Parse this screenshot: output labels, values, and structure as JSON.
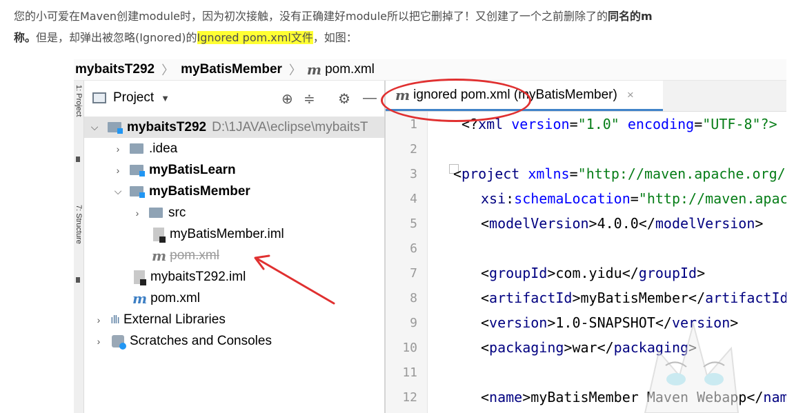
{
  "article": {
    "text_1": "您的小可爱在Maven创建module时，因为初次接触，没有正确建好module所以把它删掉了！又创建了一个之前删除了的",
    "bold_1": "同名的m",
    "bold_2": "称。",
    "text_2": "但是，却弹出被忽略(Ignored)的",
    "highlight": "Ignored pom.xml文件",
    "text_3": "，如图："
  },
  "breadcrumb": {
    "items": [
      "mybaitsT292",
      "myBatisMember",
      "pom.xml"
    ],
    "file_icon": "m"
  },
  "side_stripe": {
    "project_label": "1: Project",
    "structure_label": "7: Structure"
  },
  "project_panel": {
    "title": "Project",
    "toolbar_icons": [
      "target-icon",
      "collapse-icon",
      "gear-icon",
      "minimize-icon"
    ],
    "tree": [
      {
        "label": "mybaitsT292",
        "path": "D:\\1JAVA\\eclipse\\mybaitsT"
      },
      {
        "label": ".idea"
      },
      {
        "label": "myBatisLearn"
      },
      {
        "label": "myBatisMember"
      },
      {
        "label": "src"
      },
      {
        "label": "myBatisMember.iml"
      },
      {
        "label": "pom.xml",
        "status": "ignored"
      },
      {
        "label": "mybaitsT292.iml"
      },
      {
        "label": "pom.xml"
      },
      {
        "label": "External Libraries"
      },
      {
        "label": "Scratches and Consoles"
      }
    ]
  },
  "editor": {
    "tab": {
      "icon": "m",
      "label": "ignored pom.xml (myBatisMember)",
      "close": "×"
    },
    "line_numbers": [
      "1",
      "2",
      "3",
      "4",
      "5",
      "6",
      "7",
      "8",
      "9",
      "10",
      "11",
      "12"
    ]
  },
  "colors": {
    "highlight": "#ffff33",
    "annotation_red": "#e03030",
    "tab_underline": "#4083c9"
  }
}
